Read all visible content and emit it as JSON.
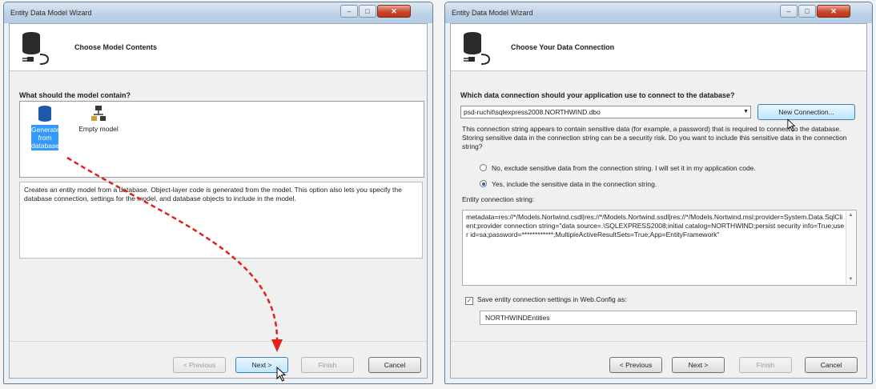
{
  "left": {
    "window_title": "Entity Data Model Wizard",
    "page_title": "Choose Model Contents",
    "question": "What should the model contain?",
    "items": [
      {
        "label": "Generate from database",
        "icon": "database-icon",
        "selected": true
      },
      {
        "label": "Empty model",
        "icon": "empty-model-icon",
        "selected": false
      }
    ],
    "description": "Creates an entity model from a database. Object-layer code is generated from the model. This option also lets you specify the database connection, settings for the model, and database objects to include in the model.",
    "buttons": {
      "previous": "< Previous",
      "next": "Next >",
      "finish": "Finish",
      "cancel": "Cancel"
    }
  },
  "right": {
    "window_title": "Entity Data Model Wizard",
    "page_title": "Choose Your Data Connection",
    "question": "Which data connection should your application use to connect to the database?",
    "connection_value": "psd-ruchit\\sqlexpress2008.NORTHWIND.dbo",
    "new_connection_label": "New Connection...",
    "sensitive_text": "This connection string appears to contain sensitive data (for example, a password) that is required to connect to the database. Storing sensitive data in the connection string can be a security risk. Do you want to include this sensitive data in the connection string?",
    "radio_no": "No, exclude sensitive data from the connection string. I will set it in my application code.",
    "radio_yes": "Yes, include the sensitive data in the connection string.",
    "entity_label": "Entity connection string:",
    "entity_string": "metadata=res://*/Models.Nortwind.csdl|res://*/Models.Nortwind.ssdl|res://*/Models.Nortwind.msl;provider=System.Data.SqlClient;provider connection string=\"data source=.\\SQLEXPRESS2008;initial catalog=NORTHWIND;persist security info=True;user id=sa;password=************;MultipleActiveResultSets=True;App=EntityFramework\"",
    "save_label": "Save entity connection settings in Web.Config as:",
    "save_checked": true,
    "entities_name": "NORTHWINDEntities",
    "buttons": {
      "previous": "< Previous",
      "next": "Next >",
      "finish": "Finish",
      "cancel": "Cancel"
    }
  },
  "colors": {
    "arrow": "#e0211b",
    "selection": "#3399ff",
    "titlebar": "#bcd1e5"
  }
}
